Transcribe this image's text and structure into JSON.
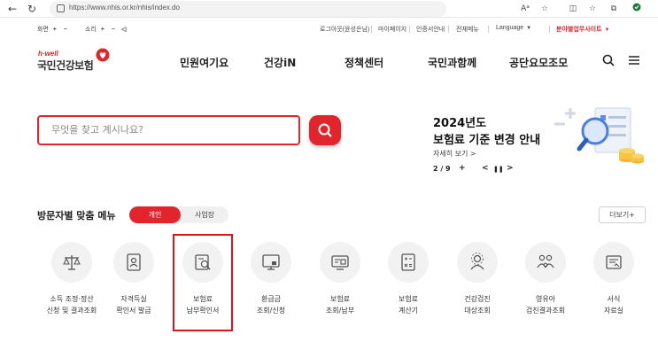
{
  "browser": {
    "url": "https://www.nhis.or.kr/nhis/index.do",
    "icons": [
      "back-icon",
      "refresh-icon",
      "read-aloud-icon",
      "favorite-icon",
      "split-icon",
      "favorites-bar-icon",
      "collections-icon",
      "extension-icon"
    ]
  },
  "utility": {
    "screen_label": "화면",
    "screen_plus": "+",
    "screen_minus": "−",
    "sound_label": "소리",
    "sound_plus": "+",
    "sound_minus": "−",
    "logout": "로그아웃(윤성은님)",
    "mypage": "마이페이지",
    "certificate": "인증서안내",
    "all_menu": "전체메뉴",
    "language": "Language",
    "related_sites": "분야별업무사이트"
  },
  "logo": {
    "small": "h·well",
    "main": "국민건강보험"
  },
  "gnb": [
    "민원여기요",
    "건강iN",
    "정책센터",
    "국민과함께",
    "공단요모조모"
  ],
  "search": {
    "placeholder": "무엇을 찾고 계시나요?"
  },
  "banner": {
    "line1": "2024년도",
    "line2": "보험료 기준 변경 안내",
    "more": "자세히 보기 >",
    "page": "2 / 9",
    "add": "+",
    "prev": "<",
    "pause": "❚❚",
    "next": ">"
  },
  "visitor_menu": {
    "title": "방문자별 맞춤 메뉴",
    "tab_personal": "개인",
    "tab_business": "사업장",
    "more_label": "더보기+",
    "items": [
      {
        "l1": "소득 조정·정산",
        "l2": "신청 및 결과조회",
        "icon": "scale-icon"
      },
      {
        "l1": "자격득실",
        "l2": "확인서 발급",
        "icon": "certificate-person-icon"
      },
      {
        "l1": "보험료",
        "l2": "납부확인서",
        "icon": "document-search-icon"
      },
      {
        "l1": "환급금",
        "l2": "조회/신청",
        "icon": "monitor-refund-icon"
      },
      {
        "l1": "보험료",
        "l2": "조회/납부",
        "icon": "bill-payment-icon"
      },
      {
        "l1": "보험료",
        "l2": "계산기",
        "icon": "calculator-icon"
      },
      {
        "l1": "건강검진",
        "l2": "대상조회",
        "icon": "health-check-person-icon"
      },
      {
        "l1": "영유아",
        "l2": "검진결과조회",
        "icon": "family-icon"
      },
      {
        "l1": "서식",
        "l2": "자료실",
        "icon": "forms-icon"
      }
    ]
  },
  "colors": {
    "accent": "#e0262c",
    "highlight": "#d3191f"
  }
}
